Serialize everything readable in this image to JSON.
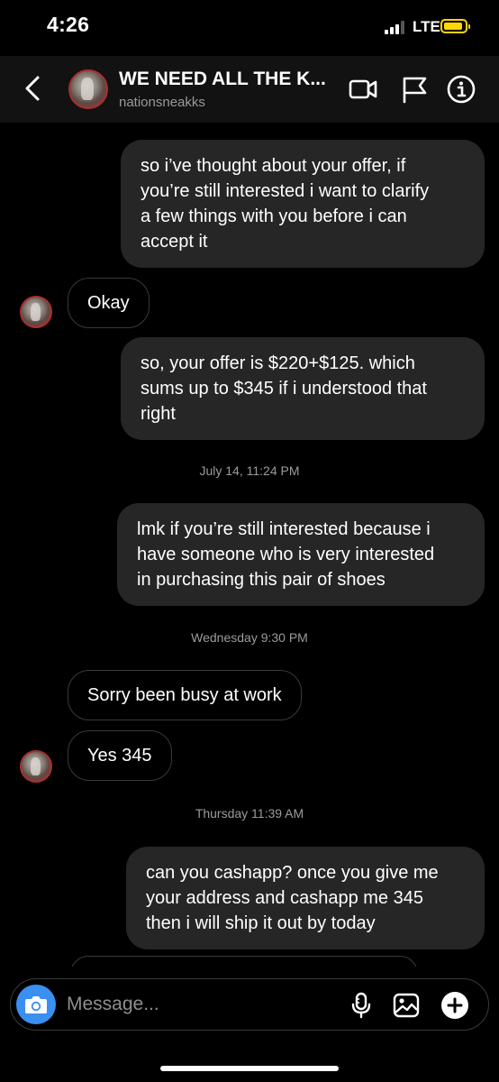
{
  "status_bar": {
    "time": "4:26",
    "network": "LTE",
    "battery_color": "#ffd60a",
    "signal_bars_active": 3
  },
  "header": {
    "title": "WE NEED ALL THE K...",
    "username": "nationsneakks",
    "icons": [
      "back-icon",
      "video-call-icon",
      "flag-icon",
      "info-icon"
    ]
  },
  "messages": [
    {
      "type": "outgoing",
      "lines": [
        "so i’ve thought about your offer, if",
        "you’re still interested i want to clarify",
        "a few things with you before i can",
        "accept it"
      ]
    },
    {
      "type": "incoming",
      "text": "Okay"
    },
    {
      "type": "outgoing",
      "lines": [
        "so, your offer is $220+$125. which",
        "sums up to $345 if i understood that",
        "right"
      ]
    },
    {
      "type": "timestamp",
      "text": "July 14, 11:24 PM"
    },
    {
      "type": "outgoing",
      "lines": [
        "lmk if you’re still interested because i",
        "have someone who is very interested",
        "in purchasing this pair of shoes"
      ]
    },
    {
      "type": "timestamp",
      "text": "Wednesday 9:30 PM"
    },
    {
      "type": "incoming",
      "text": "Sorry been busy at work"
    },
    {
      "type": "incoming",
      "text": "Yes 345"
    },
    {
      "type": "timestamp",
      "text": "Thursday 11:39 AM"
    },
    {
      "type": "outgoing",
      "lines": [
        "can you cashapp? once you give me",
        "your address and cashapp me 345",
        "then i will ship it out by today"
      ]
    }
  ],
  "composer": {
    "placeholder": "Message...",
    "icons": [
      "camera-icon",
      "microphone-icon",
      "gallery-icon",
      "plus-icon"
    ],
    "camera_button_color": "#3a8ff0"
  },
  "colors": {
    "background": "#000000",
    "header_background": "#121212",
    "outgoing_bubble": "#262626",
    "incoming_border": "#3a3a3a",
    "timestamp_text": "#9b9b9b"
  }
}
